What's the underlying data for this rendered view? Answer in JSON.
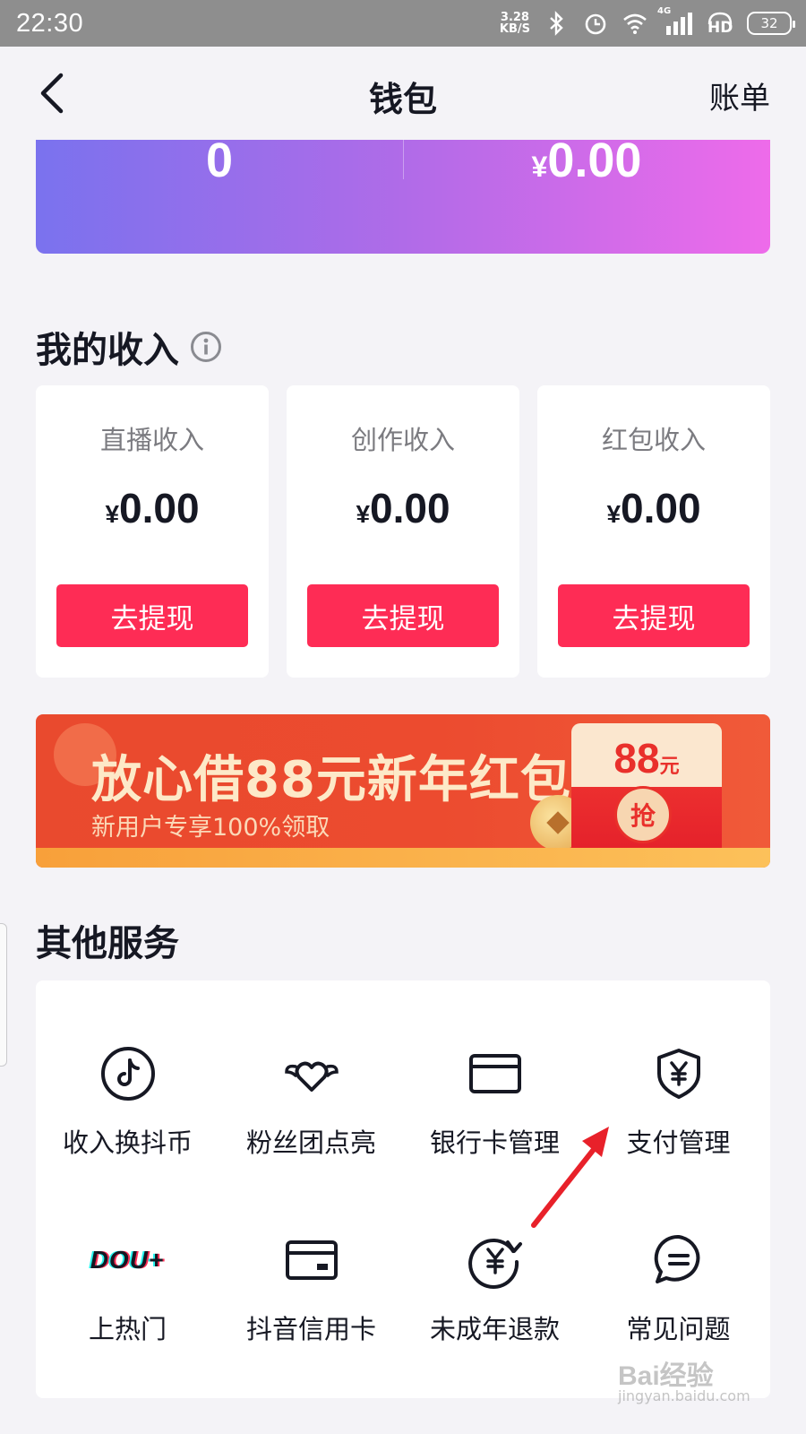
{
  "status_bar": {
    "time": "22:30",
    "net_speed_value": "3.28",
    "net_speed_unit": "KB/S",
    "network_label": "4G",
    "hd_label": "HD",
    "battery": "32"
  },
  "nav": {
    "title": "钱包",
    "bill_label": "账单"
  },
  "balance": {
    "left_value": "0",
    "right_currency": "¥",
    "right_value": "0.00",
    "gradient_start": "#7a72ee",
    "gradient_end": "#ee6bea"
  },
  "income": {
    "title": "我的收入",
    "items": [
      {
        "label": "直播收入",
        "currency": "¥",
        "amount": "0.00",
        "button": "去提现"
      },
      {
        "label": "创作收入",
        "currency": "¥",
        "amount": "0.00",
        "button": "去提现"
      },
      {
        "label": "红包收入",
        "currency": "¥",
        "amount": "0.00",
        "button": "去提现"
      }
    ]
  },
  "banner": {
    "title": "放心借88元新年红包",
    "subtitle": "新用户专享100%领取",
    "envelope_amount": "88",
    "envelope_unit": "元",
    "envelope_action": "抢"
  },
  "services": {
    "title": "其他服务",
    "items": [
      {
        "label": "收入换抖币",
        "icon": "tiktok-coin-icon"
      },
      {
        "label": "粉丝团点亮",
        "icon": "winged-heart-icon"
      },
      {
        "label": "银行卡管理",
        "icon": "bank-card-icon"
      },
      {
        "label": "支付管理",
        "icon": "yuan-shield-icon"
      },
      {
        "label": "上热门",
        "icon": "dou-plus-logo",
        "logo_text": "DOU+"
      },
      {
        "label": "抖音信用卡",
        "icon": "credit-card-icon"
      },
      {
        "label": "未成年退款",
        "icon": "yuan-refund-icon"
      },
      {
        "label": "常见问题",
        "icon": "chat-bubble-icon"
      }
    ]
  },
  "watermark": {
    "text": "Bai经验",
    "sub": "jingyan.baidu.com"
  },
  "colors": {
    "accent": "#fe2c55",
    "page_bg": "#f4f3f7",
    "arrow": "#e8212a"
  }
}
